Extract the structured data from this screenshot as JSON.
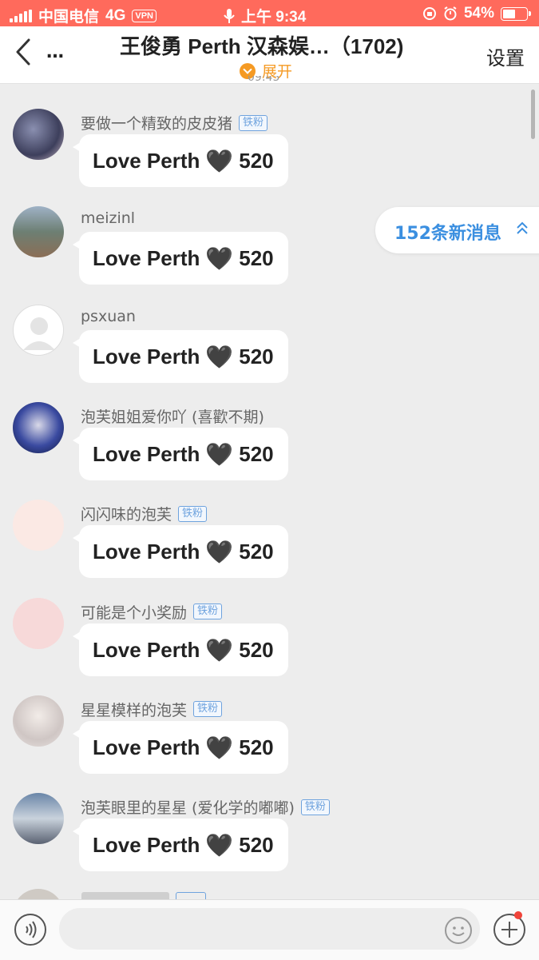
{
  "status": {
    "carrier": "中国电信",
    "network": "4G",
    "vpn": "VPN",
    "time": "上午 9:34",
    "battery": "54%",
    "battery_level": 0.54
  },
  "header": {
    "back_icon": "back-chevron-icon",
    "more": "…",
    "title": "王俊勇 Perth 汉森娱…（1702)",
    "expand_label": "展开",
    "settings_label": "设置",
    "time_peek": "09:45"
  },
  "messages": [
    {
      "username": "要做一个精致的皮皮猪",
      "badge": "铁粉",
      "text": "Love Perth",
      "number": "520"
    },
    {
      "username": "meizinl",
      "badge": "",
      "text": "Love Perth",
      "number": "520"
    },
    {
      "username": "psxuan",
      "badge": "",
      "text": "Love Perth",
      "number": "520"
    },
    {
      "username": "泡芙姐姐爱你吖 (喜歡不期)",
      "badge": "",
      "text": "Love Perth",
      "number": "520"
    },
    {
      "username": "闪闪味的泡芙",
      "badge": "铁粉",
      "text": "Love Perth",
      "number": "520"
    },
    {
      "username": "可能是个小奖励",
      "badge": "铁粉",
      "text": "Love Perth",
      "number": "520"
    },
    {
      "username": "星星模样的泡芙",
      "badge": "铁粉",
      "text": "Love Perth",
      "number": "520"
    },
    {
      "username": "泡芙眼里的星星 (爱化学的嘟嘟)",
      "badge": "铁粉",
      "text": "Love Perth",
      "number": "520"
    }
  ],
  "heart_glyph": "🖤",
  "new_messages": {
    "label": "152条新消息"
  },
  "composer": {
    "voice_icon": "voice-icon",
    "emoji_icon": "emoji-icon",
    "plus_icon": "plus-icon"
  }
}
